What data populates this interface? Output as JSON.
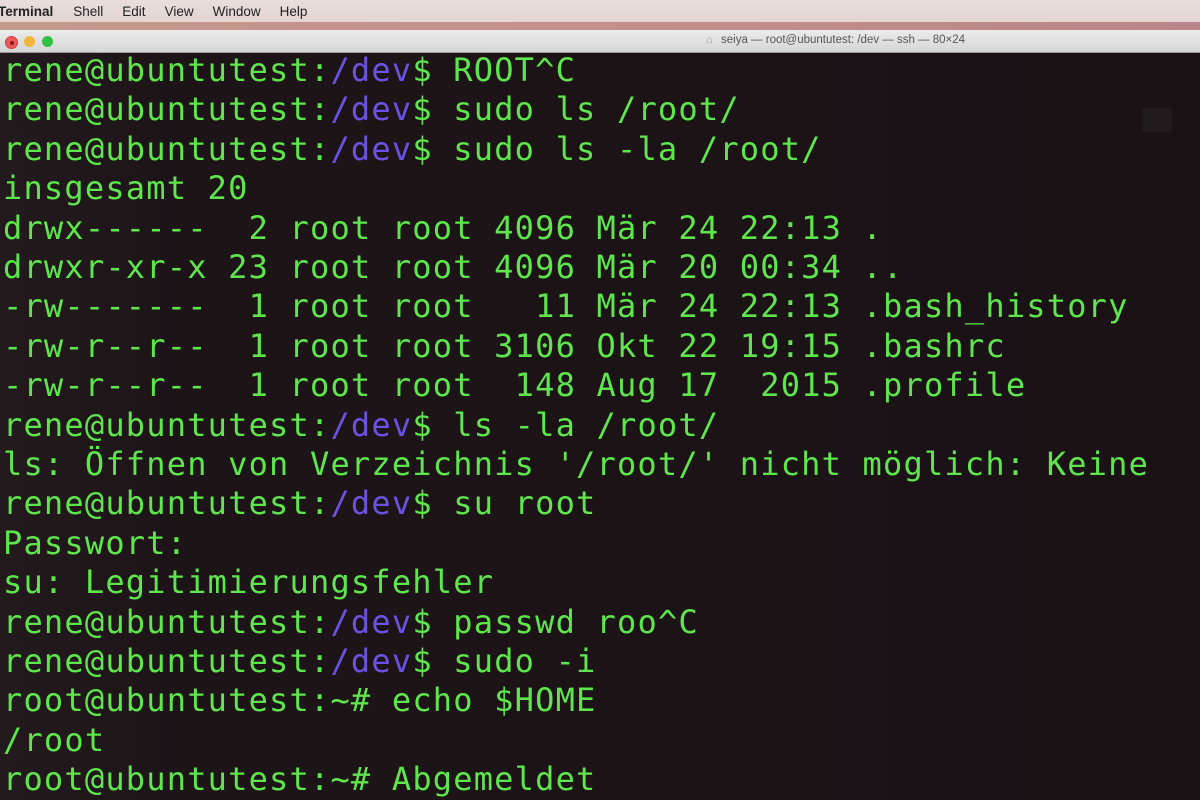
{
  "menubar": {
    "app": "Terminal",
    "items": [
      "Shell",
      "Edit",
      "View",
      "Window",
      "Help"
    ]
  },
  "window": {
    "title": "seiya — root@ubuntutest: /dev — ssh — 80×24",
    "icon": "home-icon"
  },
  "colors": {
    "text": "#5ee64c",
    "path": "#6b52e2",
    "background": "#1b1215"
  },
  "terminal": {
    "lines": [
      {
        "prompt": "rene@ubuntutest:",
        "path": "/dev",
        "suffix": "$ ",
        "text": "ROOT^C"
      },
      {
        "prompt": "rene@ubuntutest:",
        "path": "/dev",
        "suffix": "$ ",
        "text": "sudo ls /root/"
      },
      {
        "prompt": "rene@ubuntutest:",
        "path": "/dev",
        "suffix": "$ ",
        "text": "sudo ls -la /root/"
      },
      {
        "text": "insgesamt 20"
      },
      {
        "text": "drwx------  2 root root 4096 Mär 24 22:13 ."
      },
      {
        "text": "drwxr-xr-x 23 root root 4096 Mär 20 00:34 .."
      },
      {
        "text": "-rw-------  1 root root   11 Mär 24 22:13 .bash_history"
      },
      {
        "text": "-rw-r--r--  1 root root 3106 Okt 22 19:15 .bashrc"
      },
      {
        "text": "-rw-r--r--  1 root root  148 Aug 17  2015 .profile"
      },
      {
        "prompt": "rene@ubuntutest:",
        "path": "/dev",
        "suffix": "$ ",
        "text": "ls -la /root/"
      },
      {
        "text": "ls: Öffnen von Verzeichnis '/root/' nicht möglich: Keine"
      },
      {
        "prompt": "rene@ubuntutest:",
        "path": "/dev",
        "suffix": "$ ",
        "text": "su root"
      },
      {
        "text": "Passwort:"
      },
      {
        "text": "su: Legitimierungsfehler"
      },
      {
        "prompt": "rene@ubuntutest:",
        "path": "/dev",
        "suffix": "$ ",
        "text": "passwd roo^C"
      },
      {
        "prompt": "rene@ubuntutest:",
        "path": "/dev",
        "suffix": "$ ",
        "text": "sudo -i"
      },
      {
        "prompt": "root@ubuntutest:",
        "path": "",
        "suffix": "~# ",
        "text": "echo $HOME"
      },
      {
        "text": "/root"
      },
      {
        "prompt": "root@ubuntutest:",
        "path": "",
        "suffix": "~# ",
        "text": "Abgemeldet"
      }
    ]
  }
}
